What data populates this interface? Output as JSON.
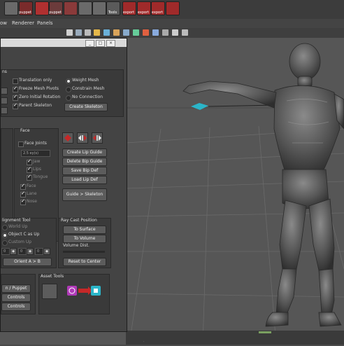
{
  "shelf": {
    "labels": [
      "",
      "puppet",
      "",
      "puppet",
      "",
      "",
      "",
      "Tools",
      "export",
      "export",
      "export",
      ""
    ],
    "label_shown": [
      "",
      "puppet",
      "",
      "puppet",
      "",
      "",
      "",
      "Tools",
      "export",
      "export",
      "export",
      ""
    ]
  },
  "menu": [
    "ow",
    "Renderer",
    "Panels"
  ],
  "window": {
    "tabs": {
      "options_title": "ns",
      "translation_only": "Translation only",
      "freeze_mesh_pivots": "Freeze Mesh Pivots",
      "zero_initial_rotation": "Zero Initial Rotation",
      "parent_skeleton": "Parent Skeleton",
      "weight_mesh": "Weight Mesh",
      "constrain_mesh": "Constrain Mesh",
      "no_connection": "No Connection",
      "create_skeleton": "Create Skeleton"
    },
    "face": {
      "title": "Face",
      "face_joints": "Face Joints",
      "field_value": "2.5 ey(s)",
      "items": [
        "Jaw",
        "Lips",
        "Tongue",
        "Face",
        "Lane",
        "Nose"
      ],
      "buttons": [
        "Create Lip Guide",
        "Delete Bip Guide",
        "Save Bip Def",
        "Load Lip Def",
        "Guide > Skeleton"
      ]
    },
    "alignment": {
      "title": "lignment Tool",
      "world_up": "World Up",
      "object_c_as_up": "Object C as Up",
      "custom_up": "Custom Up",
      "values": [
        "0",
        "0",
        "0"
      ],
      "orient_button": "Orient A > B"
    },
    "raycast": {
      "title": "Ray Cast Position",
      "to_surface": "To Surface",
      "to_volume": "To Volume",
      "volume_dist": "Volume Dist.",
      "reset": "Reset to Center"
    },
    "bottom": {
      "left_buttons": [
        "n / Puppet",
        "Controls",
        "Controls"
      ],
      "asset_tools": "Asset Tools"
    }
  },
  "colors": {
    "viewport": "#565656",
    "window": "#444444",
    "accent_red": "#c62828",
    "cyan": "#2bb5c9"
  }
}
